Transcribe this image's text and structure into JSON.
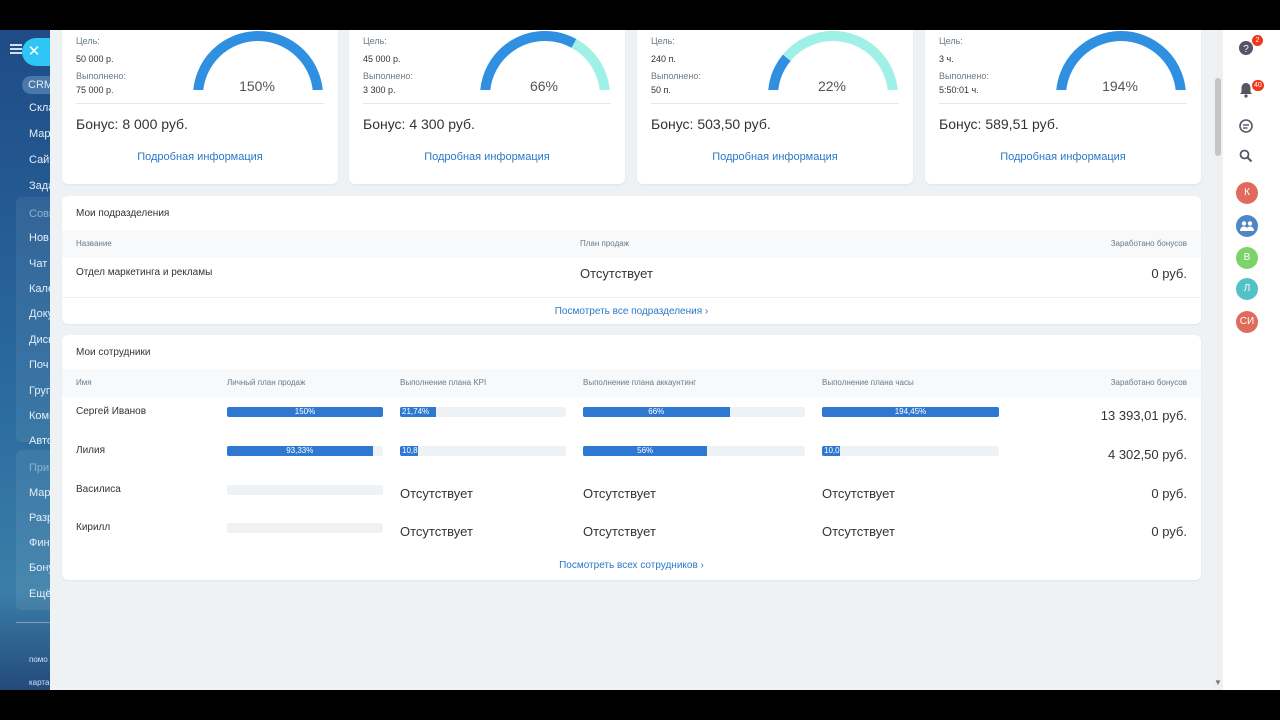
{
  "sidebar": {
    "close_symbol": "✕",
    "crm_label": "CRM",
    "items": [
      "Скла",
      "Мар",
      "Сайт",
      "Зада",
      "Совм",
      "Нов",
      "Чат и",
      "Кале",
      "Доку",
      "Диск",
      "Поч",
      "Груп",
      "Комі",
      "Авто",
      "При",
      "Мар",
      "Разр",
      "Фина",
      "Бону",
      "Ещё"
    ],
    "bottom": [
      "помо",
      "карта"
    ]
  },
  "kpi_cards": [
    {
      "goal_label": "Цель:",
      "goal": "50 000 р.",
      "done_label": "Выполнено:",
      "done": "75 000 р.",
      "percent": "150%",
      "gauge_fraction": 1.0,
      "bonus": "Бонус: 8 000 руб.",
      "more": "Подробная информация"
    },
    {
      "goal_label": "Цель:",
      "goal": "45 000 р.",
      "done_label": "Выполнено:",
      "done": "3 300 р.",
      "percent": "66%",
      "gauge_fraction": 0.66,
      "bonus": "Бонус: 4 300 руб.",
      "more": "Подробная информация"
    },
    {
      "goal_label": "Цель:",
      "goal": "240 п.",
      "done_label": "Выполнено:",
      "done": "50 п.",
      "percent": "22%",
      "gauge_fraction": 0.22,
      "bonus": "Бонус: 503,50 руб.",
      "more": "Подробная информация"
    },
    {
      "goal_label": "Цель:",
      "goal": "3 ч.",
      "done_label": "Выполнено:",
      "done": "5:50:01 ч.",
      "percent": "194%",
      "gauge_fraction": 1.0,
      "bonus": "Бонус: 589,51 руб.",
      "more": "Подробная информация"
    }
  ],
  "departments": {
    "title": "Мои подразделения",
    "columns": [
      "Название",
      "План продаж",
      "Заработано бонусов"
    ],
    "rows": [
      {
        "name": "Отдел маркетинга и рекламы",
        "plan": "Отсутствует",
        "bonus": "0 руб."
      }
    ],
    "footer": "Посмотреть все подразделения ›"
  },
  "employees": {
    "title": "Мои сотрудники",
    "columns": [
      "Имя",
      "Личный план продаж",
      "Выполнение плана KPI",
      "Выполнение плана аккаунтинг",
      "Выполнение плана часы",
      "Заработано бонусов"
    ],
    "rows": [
      {
        "name": "Сергей Иванов",
        "bonus": "13 393,01 руб.",
        "cells": [
          {
            "type": "bar",
            "label": "150%",
            "fraction": 1.0
          },
          {
            "type": "bar",
            "label": "21,74%",
            "fraction": 0.2174
          },
          {
            "type": "bar",
            "label": "66%",
            "fraction": 0.66
          },
          {
            "type": "bar",
            "label": "194,45%",
            "fraction": 1.0
          }
        ]
      },
      {
        "name": "Лилия",
        "bonus": "4 302,50 руб.",
        "cells": [
          {
            "type": "bar",
            "label": "93,33%",
            "fraction": 0.9333
          },
          {
            "type": "bar",
            "label": "10,8",
            "fraction": 0.108
          },
          {
            "type": "bar",
            "label": "56%",
            "fraction": 0.56
          },
          {
            "type": "bar",
            "label": "10,0",
            "fraction": 0.1
          }
        ]
      },
      {
        "name": "Василиса",
        "bonus": "0 руб.",
        "cells": [
          {
            "type": "bar",
            "label": "",
            "fraction": 0
          },
          {
            "type": "text",
            "label": "Отсутствует"
          },
          {
            "type": "text",
            "label": "Отсутствует"
          },
          {
            "type": "text",
            "label": "Отсутствует"
          }
        ]
      },
      {
        "name": "Кирилл",
        "bonus": "0 руб.",
        "cells": [
          {
            "type": "bar",
            "label": "",
            "fraction": 0
          },
          {
            "type": "text",
            "label": "Отсутствует"
          },
          {
            "type": "text",
            "label": "Отсутствует"
          },
          {
            "type": "text",
            "label": "Отсутствует"
          }
        ]
      }
    ],
    "footer": "Посмотреть всех сотрудников ›"
  },
  "rightbar": {
    "help_badge": "2",
    "notif_badge": "40",
    "avatars": [
      {
        "initials": "К",
        "color": "#e06b5c"
      },
      {
        "initials": "",
        "color": "#4f86c6",
        "icon": "group-icon"
      },
      {
        "initials": "В",
        "color": "#7bd36a"
      },
      {
        "initials": "Л",
        "color": "#52c2c6"
      },
      {
        "initials": "СИ",
        "color": "#e06b5c"
      }
    ]
  },
  "colors": {
    "accent": "#2a79c9",
    "bar": "#2f78d2",
    "gauge_done": "#2f8fe0",
    "gauge_rest": "#9ff0e6"
  }
}
